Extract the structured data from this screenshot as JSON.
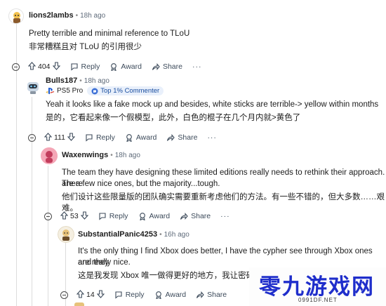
{
  "comments": [
    {
      "username": "lions2lambs",
      "time": "18h ago",
      "text_en": "Pretty terrible and minimal reference to TLoU",
      "text_zh": "非常糟糕且对 TLoU 的引用很少",
      "score": "404",
      "reply_label": "Reply",
      "award_label": "Award",
      "share_label": "Share",
      "more_label": "···"
    },
    {
      "username": "Bulls187",
      "time": "18h ago",
      "flair": "PS5 Pro",
      "badge": "Top 1% Commenter",
      "text_en": "Yeah it looks like a fake mock up and besides, white sticks are terrible-> yellow within months",
      "text_zh": "是的，它看起来像一个假模型，此外，白色的棍子在几个月内就>黄色了",
      "score": "111",
      "reply_label": "Reply",
      "award_label": "Award",
      "share_label": "Share",
      "more_label": "···"
    },
    {
      "username": "Waxenwings",
      "time": "18h ago",
      "text_en_1": "The team they have designing these limited editions really needs to rethink their approach. There",
      "text_en_2": "are a few nice ones, but the majority...tough.",
      "text_zh": "他们设计这些限量版的团队确实需要重新考虑他们的方法。有一些不错的，但大多数……艰难。",
      "score": "53",
      "reply_label": "Reply",
      "award_label": "Award",
      "share_label": "Share",
      "more_label": "···"
    },
    {
      "username": "SubstantialPanic4253",
      "time": "16h ago",
      "text_en_1": "It's the only thing I find Xbox does better, I have the cypher see through Xbox ones and they",
      "text_en_2": "are really nice.",
      "text_zh": "这是我发现 Xbox 唯一做得更好的地方，我让密码看穿",
      "score": "14",
      "reply_label": "Reply",
      "award_label": "Award",
      "share_label": "Share"
    }
  ],
  "watermark": {
    "logo_text": "零九游戏网",
    "url": "0991DF.NET"
  },
  "colors": {
    "accent_blue": "#1f2ecb",
    "badge_bg": "#e9f0fb",
    "thread_line": "#dcdcdc"
  }
}
